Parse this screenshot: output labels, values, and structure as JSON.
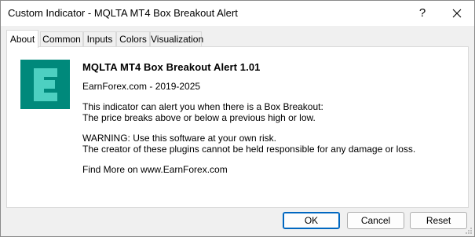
{
  "window": {
    "title": "Custom Indicator - MQLTA MT4 Box Breakout Alert",
    "help_label": "?",
    "close_icon": "close-icon"
  },
  "tabs": [
    {
      "label": "About",
      "active": true
    },
    {
      "label": "Common",
      "active": false
    },
    {
      "label": "Inputs",
      "active": false
    },
    {
      "label": "Colors",
      "active": false
    },
    {
      "label": "Visualization",
      "active": false
    }
  ],
  "about": {
    "logo_icon": "earnforex-logo-icon",
    "logo_colors": {
      "dark": "#00897b",
      "light": "#4dd0c1"
    },
    "heading": "MQLTA MT4 Box Breakout Alert 1.01",
    "copyright": "EarnForex.com - 2019-2025",
    "description_1": "This indicator can alert you when there is a Box Breakout:",
    "description_2": "The price breaks above or below a previous high or low.",
    "warning_1": "WARNING: Use this software at your own risk.",
    "warning_2": "The creator of these plugins cannot be held responsible for any damage or loss.",
    "more": "Find More on www.EarnForex.com"
  },
  "buttons": {
    "ok": "OK",
    "cancel": "Cancel",
    "reset": "Reset"
  },
  "colors": {
    "accent": "#0067c0"
  }
}
